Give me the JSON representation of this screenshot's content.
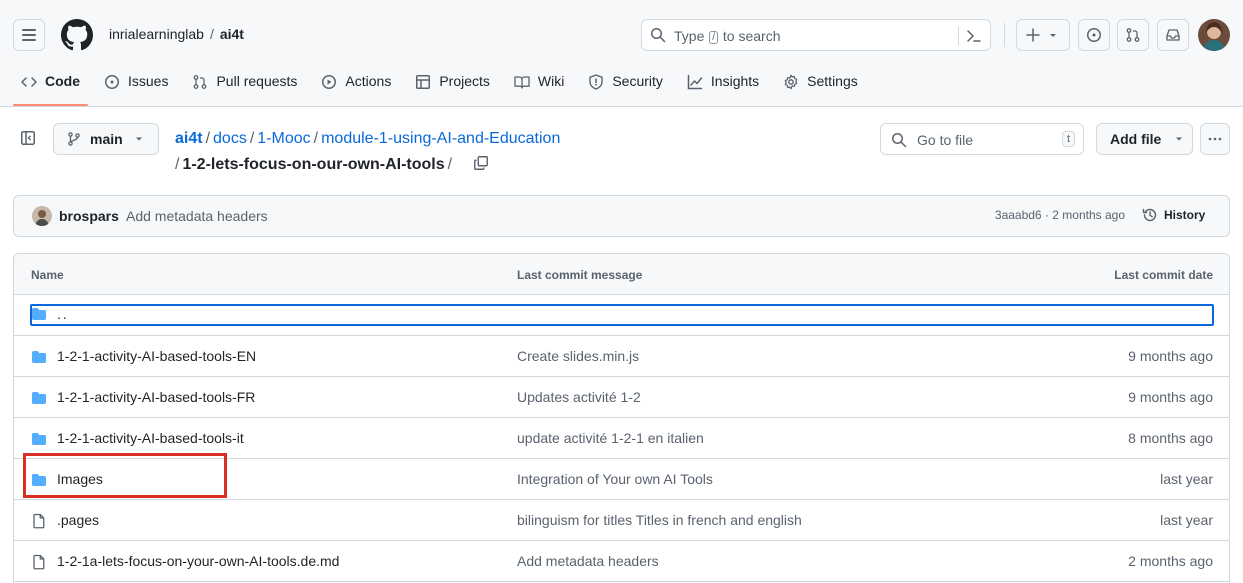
{
  "header": {
    "owner": "inrialearninglab",
    "separator": "/",
    "repo": "ai4t",
    "search": {
      "prefix": "Type",
      "key": "/",
      "suffix": "to search"
    }
  },
  "tabs": [
    {
      "label": "Code",
      "icon": "code-icon",
      "active": true
    },
    {
      "label": "Issues",
      "icon": "issue-icon"
    },
    {
      "label": "Pull requests",
      "icon": "pull-request-icon"
    },
    {
      "label": "Actions",
      "icon": "play-icon"
    },
    {
      "label": "Projects",
      "icon": "table-icon"
    },
    {
      "label": "Wiki",
      "icon": "book-icon"
    },
    {
      "label": "Security",
      "icon": "shield-icon"
    },
    {
      "label": "Insights",
      "icon": "graph-icon"
    },
    {
      "label": "Settings",
      "icon": "gear-icon"
    }
  ],
  "branch": {
    "label": "main"
  },
  "path": {
    "segments": [
      "ai4t",
      "docs",
      "1-Mooc",
      "module-1-using-AI-and-Education"
    ],
    "current": "1-2-lets-focus-on-our-own-AI-tools",
    "sep": "/"
  },
  "goto": {
    "placeholder": "Go to file",
    "shortcut": "t"
  },
  "add_file": "Add file",
  "commit": {
    "author": "brospars",
    "message": "Add metadata headers",
    "meta": "3aaabd6 · 2 months ago",
    "history": "History"
  },
  "table": {
    "headers": {
      "name": "Name",
      "message": "Last commit message",
      "date": "Last commit date"
    },
    "parent": "..",
    "rows": [
      {
        "type": "folder",
        "name": "1-2-1-activity-AI-based-tools-EN",
        "message": "Create slides.min.js",
        "date": "9 months ago"
      },
      {
        "type": "folder",
        "name": "1-2-1-activity-AI-based-tools-FR",
        "message": "Updates activité 1-2",
        "date": "9 months ago"
      },
      {
        "type": "folder",
        "name": "1-2-1-activity-AI-based-tools-it",
        "message": "update activité 1-2-1 en italien",
        "date": "8 months ago"
      },
      {
        "type": "folder",
        "name": "Images",
        "message": "Integration of Your own AI Tools",
        "date": "last year"
      },
      {
        "type": "file",
        "name": ".pages",
        "message": "bilinguism for titles Titles in french and english",
        "date": "last year"
      },
      {
        "type": "file",
        "name": "1-2-1a-lets-focus-on-your-own-AI-tools.de.md",
        "message": "Add metadata headers",
        "date": "2 months ago"
      }
    ]
  },
  "colors": {
    "accent": "#0969da",
    "tab_underline": "#fd8c73",
    "folder": "#54aeff",
    "highlight_box": "#d93025"
  }
}
